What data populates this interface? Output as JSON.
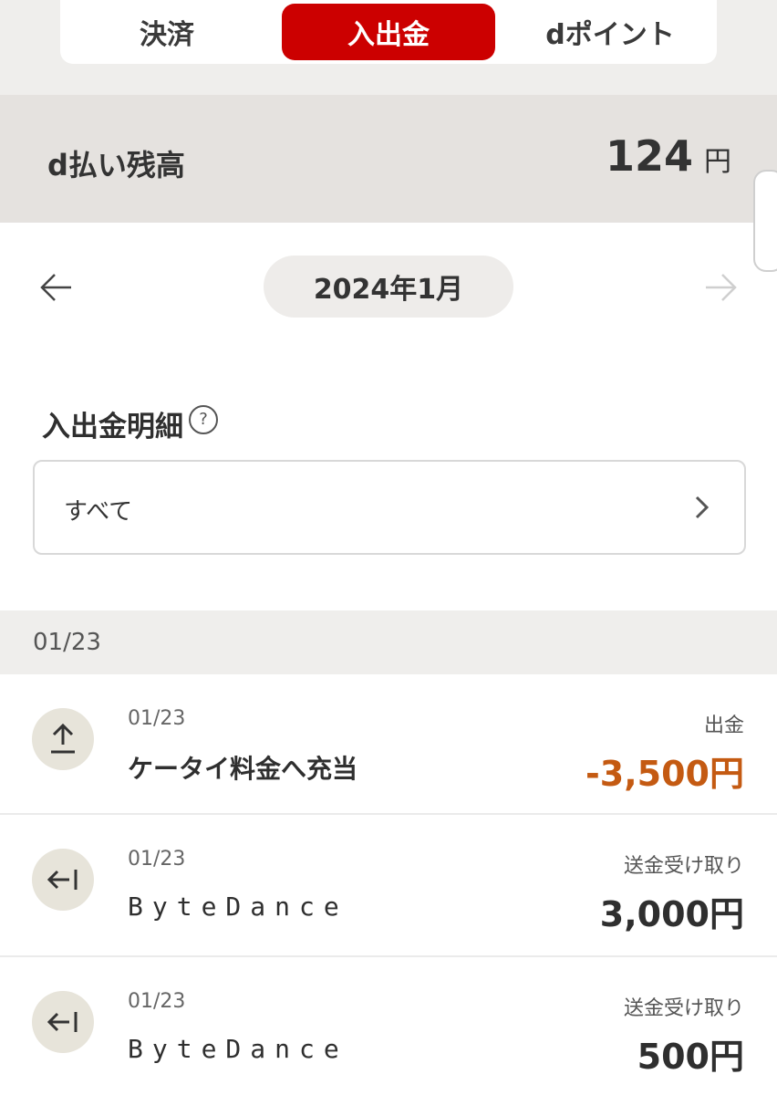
{
  "tabs": [
    {
      "label": "決済"
    },
    {
      "label": "入出金"
    },
    {
      "label": "dポイント"
    }
  ],
  "balance": {
    "label": "d払い残高",
    "amount": "124",
    "unit": "円"
  },
  "month": {
    "label": "2024年1月"
  },
  "section": {
    "title": "入出金明細",
    "help_icon": "?"
  },
  "filter": {
    "label": "すべて"
  },
  "date_group": {
    "label": "01/23"
  },
  "transactions": [
    {
      "date": "01/23",
      "name": "ケータイ料金へ充当",
      "type": "出金",
      "amount": "-3,500円",
      "icon": "upload-icon"
    },
    {
      "date": "01/23",
      "name": "ByteDance",
      "type": "送金受け取り",
      "amount": "3,000円",
      "icon": "receive-icon"
    },
    {
      "date": "01/23",
      "name": "ByteDance",
      "type": "送金受け取り",
      "amount": "500円",
      "icon": "receive-icon"
    }
  ],
  "colors": {
    "accent": "#cc0000",
    "outgoing": "#c45a12"
  }
}
